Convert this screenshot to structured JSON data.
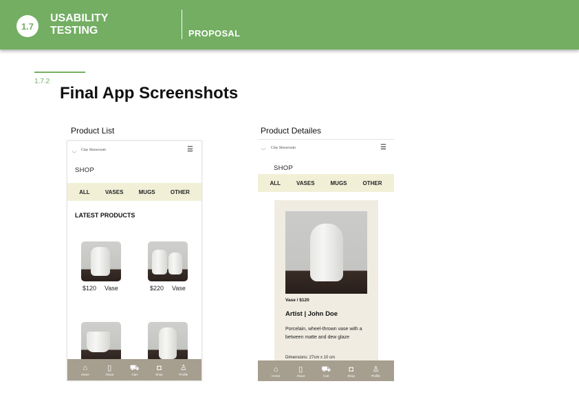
{
  "header": {
    "section_number": "1.7",
    "title_line1": "USABILITY",
    "title_line2": "TESTING",
    "subtitle": "PROPOSAL"
  },
  "subsection_number": "1.7.2",
  "page_title": "Final App Screenshots",
  "screens": {
    "product_list": {
      "caption": "Product List",
      "brand": "Clay Showroom",
      "shop_label": "SHOP",
      "categories": [
        "ALL",
        "VASES",
        "MUGS",
        "OTHER"
      ],
      "latest_label": "LATEST PRODUCTS",
      "products": [
        {
          "price": "$120",
          "name": "Vase"
        },
        {
          "price": "$220",
          "name": "Vase"
        }
      ]
    },
    "product_details": {
      "caption": "Product Detailes",
      "brand": "Clay Showroom",
      "shop_label": "SHOP",
      "categories": [
        "ALL",
        "VASES",
        "MUGS",
        "OTHER"
      ],
      "meta": "Vase / $120",
      "artist": "Artist | John Doe",
      "description": "Porcelain, wheel-thrown vase with a between matte and dew glaze",
      "dimensions": "Dimensions: 27cm x 10 cm"
    }
  },
  "bottom_nav": [
    {
      "label": "Home",
      "icon": "home-icon"
    },
    {
      "label": "About",
      "icon": "book-icon"
    },
    {
      "label": "Cart",
      "icon": "cart-icon"
    },
    {
      "label": "Shop",
      "icon": "bag-icon"
    },
    {
      "label": "Profile",
      "icon": "person-icon"
    }
  ],
  "colors": {
    "header_green": "#73ae63",
    "category_bar": "#f1f0d7",
    "bottom_nav": "#a69e8f",
    "detail_card": "#f0ece1"
  }
}
